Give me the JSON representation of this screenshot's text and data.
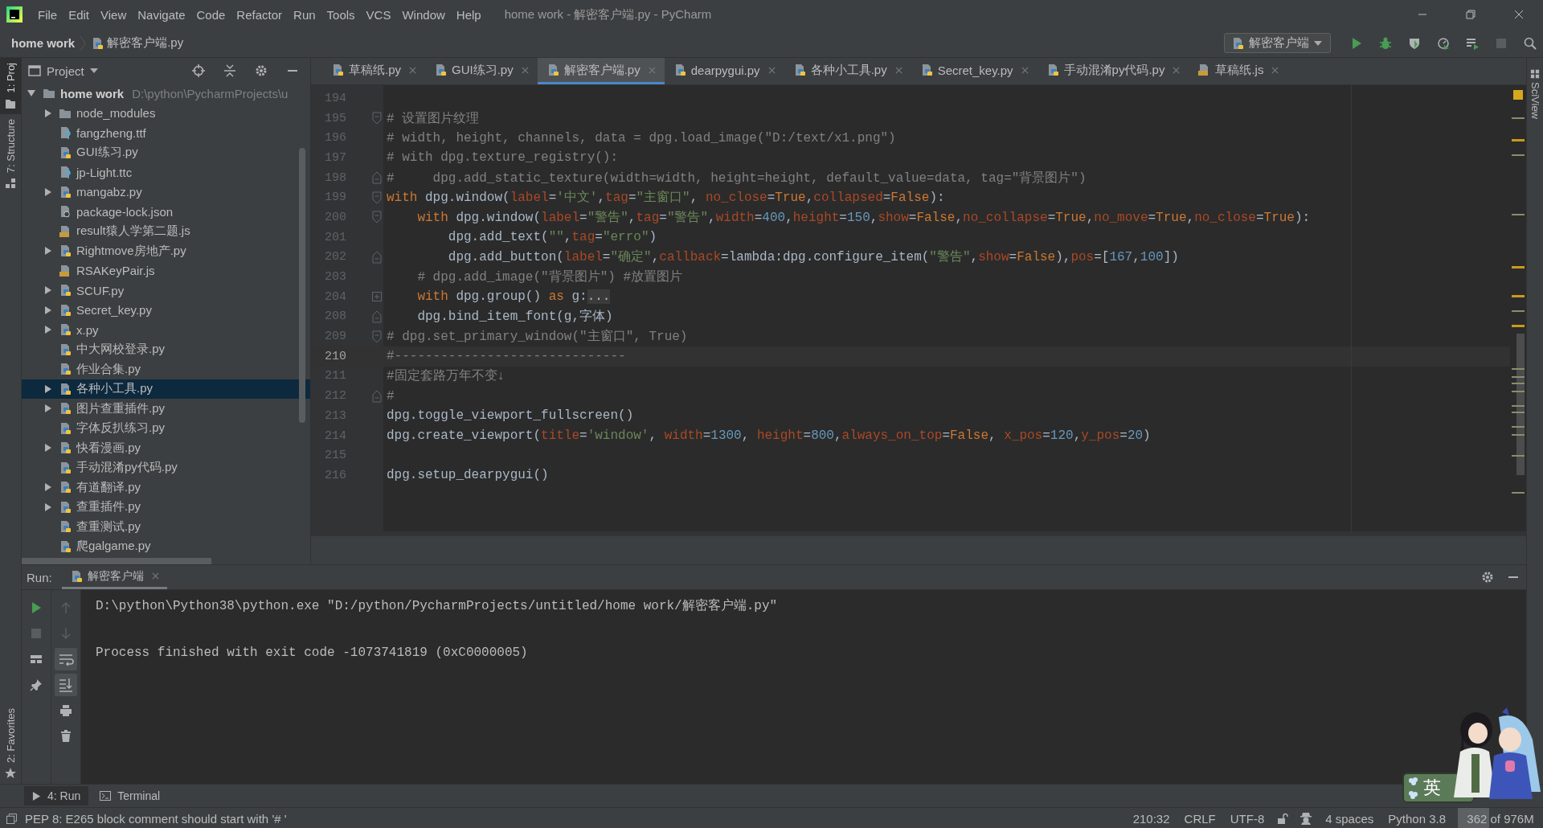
{
  "window": {
    "title": "home work - 解密客户端.py - PyCharm"
  },
  "menu": [
    "File",
    "Edit",
    "View",
    "Navigate",
    "Code",
    "Refactor",
    "Run",
    "Tools",
    "VCS",
    "Window",
    "Help"
  ],
  "breadcrumb": [
    {
      "label": "home work"
    },
    {
      "label": "解密客户端.py",
      "kind": "python"
    }
  ],
  "run_config": {
    "label": "解密客户端"
  },
  "side_tabs": {
    "left": [
      {
        "label": "1: Proj",
        "kind": "project",
        "selected": true
      },
      {
        "label": "7: Structure",
        "kind": "structure",
        "selected": false
      }
    ],
    "favorites": {
      "label": "2: Favorites"
    },
    "right": {
      "label": "SciView"
    }
  },
  "project": {
    "title": "Project",
    "tree": [
      {
        "label": "home work",
        "path": "D:\\python\\PycharmProjects\\u",
        "kind": "folder",
        "expanded": true,
        "selected": false,
        "children": [
          {
            "label": "node_modules",
            "kind": "folder",
            "expanded": false,
            "selected": false
          },
          {
            "label": "fangzheng.ttf",
            "kind": "font",
            "selected": false
          },
          {
            "label": "GUI练习.py",
            "kind": "python",
            "selected": false
          },
          {
            "label": "jp-Light.ttc",
            "kind": "font",
            "selected": false
          },
          {
            "label": "mangabz.py",
            "kind": "python",
            "expanded": false,
            "selected": false
          },
          {
            "label": "package-lock.json",
            "kind": "json",
            "selected": false
          },
          {
            "label": "result猿人学第二题.js",
            "kind": "js",
            "selected": false
          },
          {
            "label": "Rightmove房地产.py",
            "kind": "python",
            "expanded": false,
            "selected": false
          },
          {
            "label": "RSAKeyPair.js",
            "kind": "js",
            "selected": false
          },
          {
            "label": "SCUF.py",
            "kind": "python",
            "expanded": false,
            "selected": false
          },
          {
            "label": "Secret_key.py",
            "kind": "python",
            "expanded": false,
            "selected": false
          },
          {
            "label": "x.py",
            "kind": "python",
            "expanded": false,
            "selected": false
          },
          {
            "label": "中大网校登录.py",
            "kind": "python",
            "selected": false
          },
          {
            "label": "作业合集.py",
            "kind": "python",
            "selected": false
          },
          {
            "label": "各种小工具.py",
            "kind": "python",
            "expanded": false,
            "selected": true
          },
          {
            "label": "图片查重插件.py",
            "kind": "python",
            "expanded": false,
            "selected": false
          },
          {
            "label": "字体反扒练习.py",
            "kind": "python",
            "selected": false
          },
          {
            "label": "快看漫画.py",
            "kind": "python",
            "expanded": false,
            "selected": false
          },
          {
            "label": "手动混淆py代码.py",
            "kind": "python",
            "selected": false
          },
          {
            "label": "有道翻译.py",
            "kind": "python",
            "expanded": false,
            "selected": false
          },
          {
            "label": "查重插件.py",
            "kind": "python",
            "expanded": false,
            "selected": false
          },
          {
            "label": "查重测试.py",
            "kind": "python",
            "selected": false
          },
          {
            "label": "爬galgame.py",
            "kind": "python",
            "selected": false
          }
        ]
      }
    ]
  },
  "editor": {
    "tabs": [
      {
        "label": "草稿纸.py",
        "kind": "python",
        "selected": false
      },
      {
        "label": "GUI练习.py",
        "kind": "python",
        "selected": false
      },
      {
        "label": "解密客户端.py",
        "kind": "python",
        "selected": true
      },
      {
        "label": "dearpygui.py",
        "kind": "python",
        "selected": false
      },
      {
        "label": "各种小工具.py",
        "kind": "python",
        "selected": false
      },
      {
        "label": "Secret_key.py",
        "kind": "python",
        "selected": false
      },
      {
        "label": "手动混淆py代码.py",
        "kind": "python",
        "selected": false
      },
      {
        "label": "草稿纸.js",
        "kind": "js",
        "selected": false
      }
    ],
    "lines": [
      {
        "number": "194",
        "kind": "plain",
        "current": false
      },
      {
        "number": "195",
        "kind": "fold_start",
        "current": false,
        "tokens": [
          {
            "text": "# 设置图片纹理",
            "kind": "comment"
          }
        ]
      },
      {
        "number": "196",
        "kind": "plain",
        "current": false,
        "tokens": [
          {
            "text": "# width, height, channels, data = dpg.load_image(\"D:/text/x1.png\")",
            "kind": "comment"
          }
        ]
      },
      {
        "number": "197",
        "kind": "plain",
        "current": false,
        "tokens": [
          {
            "text": "# with dpg.texture_registry():",
            "kind": "comment"
          }
        ]
      },
      {
        "number": "198",
        "kind": "fold_end",
        "current": false,
        "tokens": [
          {
            "text": "#     dpg.add_static_texture(width=width, height=height, default_value=data, tag=\"背景图片\")",
            "kind": "comment"
          }
        ]
      },
      {
        "number": "199",
        "kind": "fold_start",
        "current": false,
        "tokens": [
          {
            "text": "with",
            "kind": "keyword"
          },
          {
            "text": " dpg.window(",
            "kind": "plain"
          },
          {
            "text": "label",
            "kind": "param"
          },
          {
            "text": "=",
            "kind": "plain"
          },
          {
            "text": "'中文'",
            "kind": "string"
          },
          {
            "text": ",",
            "kind": "plain"
          },
          {
            "text": "tag",
            "kind": "param"
          },
          {
            "text": "=",
            "kind": "plain"
          },
          {
            "text": "\"主窗口\"",
            "kind": "string"
          },
          {
            "text": ", ",
            "kind": "plain"
          },
          {
            "text": "no_close",
            "kind": "param"
          },
          {
            "text": "=",
            "kind": "plain"
          },
          {
            "text": "True",
            "kind": "keyword"
          },
          {
            "text": ",",
            "kind": "plain"
          },
          {
            "text": "collapsed",
            "kind": "param"
          },
          {
            "text": "=",
            "kind": "plain"
          },
          {
            "text": "False",
            "kind": "keyword"
          },
          {
            "text": "):",
            "kind": "plain"
          }
        ]
      },
      {
        "number": "200",
        "kind": "fold_start",
        "current": false,
        "tokens": [
          {
            "text": "    with",
            "kind": "keyword"
          },
          {
            "text": " dpg.window(",
            "kind": "plain"
          },
          {
            "text": "label",
            "kind": "param"
          },
          {
            "text": "=",
            "kind": "plain"
          },
          {
            "text": "\"警告\"",
            "kind": "string"
          },
          {
            "text": ",",
            "kind": "plain"
          },
          {
            "text": "tag",
            "kind": "param"
          },
          {
            "text": "=",
            "kind": "plain"
          },
          {
            "text": "\"警告\"",
            "kind": "string"
          },
          {
            "text": ",",
            "kind": "plain"
          },
          {
            "text": "width",
            "kind": "param"
          },
          {
            "text": "=",
            "kind": "plain"
          },
          {
            "text": "400",
            "kind": "number"
          },
          {
            "text": ",",
            "kind": "plain"
          },
          {
            "text": "height",
            "kind": "param"
          },
          {
            "text": "=",
            "kind": "plain"
          },
          {
            "text": "150",
            "kind": "number"
          },
          {
            "text": ",",
            "kind": "plain"
          },
          {
            "text": "show",
            "kind": "param"
          },
          {
            "text": "=",
            "kind": "plain"
          },
          {
            "text": "False",
            "kind": "keyword"
          },
          {
            "text": ",",
            "kind": "plain"
          },
          {
            "text": "no_collapse",
            "kind": "param"
          },
          {
            "text": "=",
            "kind": "plain"
          },
          {
            "text": "True",
            "kind": "keyword"
          },
          {
            "text": ",",
            "kind": "plain"
          },
          {
            "text": "no_move",
            "kind": "param"
          },
          {
            "text": "=",
            "kind": "plain"
          },
          {
            "text": "True",
            "kind": "keyword"
          },
          {
            "text": ",",
            "kind": "plain"
          },
          {
            "text": "no_close",
            "kind": "param"
          },
          {
            "text": "=",
            "kind": "plain"
          },
          {
            "text": "True",
            "kind": "keyword"
          },
          {
            "text": "):",
            "kind": "plain"
          }
        ]
      },
      {
        "number": "201",
        "kind": "plain",
        "current": false,
        "tokens": [
          {
            "text": "        dpg.add_text(",
            "kind": "plain"
          },
          {
            "text": "\"\"",
            "kind": "string"
          },
          {
            "text": ",",
            "kind": "plain"
          },
          {
            "text": "tag",
            "kind": "param"
          },
          {
            "text": "=",
            "kind": "plain"
          },
          {
            "text": "\"erro\"",
            "kind": "string"
          },
          {
            "text": ")",
            "kind": "plain"
          }
        ]
      },
      {
        "number": "202",
        "kind": "fold_end",
        "current": false,
        "tokens": [
          {
            "text": "        dpg.add_button(",
            "kind": "plain"
          },
          {
            "text": "label",
            "kind": "param"
          },
          {
            "text": "=",
            "kind": "plain"
          },
          {
            "text": "\"确定\"",
            "kind": "string"
          },
          {
            "text": ",",
            "kind": "plain"
          },
          {
            "text": "callback",
            "kind": "param"
          },
          {
            "text": "=lambda:dpg.configure_item(",
            "kind": "plain"
          },
          {
            "text": "\"警告\"",
            "kind": "string"
          },
          {
            "text": ",",
            "kind": "plain"
          },
          {
            "text": "show",
            "kind": "param"
          },
          {
            "text": "=",
            "kind": "plain"
          },
          {
            "text": "False",
            "kind": "keyword"
          },
          {
            "text": "),",
            "kind": "plain"
          },
          {
            "text": "pos",
            "kind": "param"
          },
          {
            "text": "=[",
            "kind": "plain"
          },
          {
            "text": "167",
            "kind": "number"
          },
          {
            "text": ",",
            "kind": "plain"
          },
          {
            "text": "100",
            "kind": "number"
          },
          {
            "text": "])",
            "kind": "plain"
          }
        ]
      },
      {
        "number": "203",
        "kind": "plain",
        "current": false,
        "tokens": [
          {
            "text": "    # dpg.add_image(\"背景图片\") #放置图片",
            "kind": "comment"
          }
        ]
      },
      {
        "number": "204",
        "kind": "fold_collapsed",
        "current": false,
        "tokens": [
          {
            "text": "    with",
            "kind": "keyword"
          },
          {
            "text": " dpg.group() ",
            "kind": "plain"
          },
          {
            "text": "as",
            "kind": "keyword"
          },
          {
            "text": " g:",
            "kind": "plain"
          },
          {
            "text": "...",
            "kind": "folded"
          }
        ]
      },
      {
        "number": "208",
        "kind": "fold_end",
        "current": false,
        "tokens": [
          {
            "text": "    dpg.bind_item_font(g,字体)",
            "kind": "plain"
          }
        ]
      },
      {
        "number": "209",
        "kind": "fold_start",
        "current": false,
        "tokens": [
          {
            "text": "# dpg.set_primary_window(\"主窗口\", True)",
            "kind": "comment"
          }
        ]
      },
      {
        "number": "210",
        "kind": "plain",
        "current": true,
        "tokens": [
          {
            "text": "#------------------------------",
            "kind": "comment"
          }
        ]
      },
      {
        "number": "211",
        "kind": "plain",
        "current": false,
        "tokens": [
          {
            "text": "#固定套路万年不变↓",
            "kind": "comment"
          }
        ]
      },
      {
        "number": "212",
        "kind": "fold_end",
        "current": false,
        "tokens": [
          {
            "text": "#",
            "kind": "comment"
          }
        ]
      },
      {
        "number": "213",
        "kind": "plain",
        "current": false,
        "tokens": [
          {
            "text": "dpg.toggle_viewport_fullscreen()",
            "kind": "plain"
          }
        ]
      },
      {
        "number": "214",
        "kind": "plain",
        "current": false,
        "tokens": [
          {
            "text": "dpg.create_viewport(",
            "kind": "plain"
          },
          {
            "text": "title",
            "kind": "param"
          },
          {
            "text": "=",
            "kind": "plain"
          },
          {
            "text": "'window'",
            "kind": "string"
          },
          {
            "text": ", ",
            "kind": "plain"
          },
          {
            "text": "width",
            "kind": "param"
          },
          {
            "text": "=",
            "kind": "plain"
          },
          {
            "text": "1300",
            "kind": "number"
          },
          {
            "text": ", ",
            "kind": "plain"
          },
          {
            "text": "height",
            "kind": "param"
          },
          {
            "text": "=",
            "kind": "plain"
          },
          {
            "text": "800",
            "kind": "number"
          },
          {
            "text": ",",
            "kind": "plain"
          },
          {
            "text": "always_on_top",
            "kind": "param"
          },
          {
            "text": "=",
            "kind": "plain"
          },
          {
            "text": "False",
            "kind": "keyword"
          },
          {
            "text": ", ",
            "kind": "plain"
          },
          {
            "text": "x_pos",
            "kind": "param"
          },
          {
            "text": "=",
            "kind": "plain"
          },
          {
            "text": "120",
            "kind": "number"
          },
          {
            "text": ",",
            "kind": "plain"
          },
          {
            "text": "y_pos",
            "kind": "param"
          },
          {
            "text": "=",
            "kind": "plain"
          },
          {
            "text": "20",
            "kind": "number"
          },
          {
            "text": ")",
            "kind": "plain"
          }
        ]
      },
      {
        "number": "215",
        "kind": "plain",
        "current": false
      },
      {
        "number": "216",
        "kind": "plain",
        "current": false,
        "tokens": [
          {
            "text": "dpg.setup_dearpygui()",
            "kind": "plain"
          }
        ]
      }
    ]
  },
  "run": {
    "label": "Run:",
    "tabs": [
      {
        "label": "解密客户端",
        "selected": true
      }
    ],
    "output": [
      "D:\\python\\Python38\\python.exe \"D:/python/PycharmProjects/untitled/home work/解密客户端.py\"",
      "Process finished with exit code -1073741819 (0xC0000005)"
    ]
  },
  "tool_windows": [
    {
      "label": "4: Run",
      "kind": "run",
      "selected": true
    },
    {
      "label": "Terminal",
      "kind": "terminal",
      "selected": false
    }
  ],
  "status_bar": {
    "message": "PEP 8: E265 block comment should start with '# '",
    "position": "210:32",
    "line_separator": "CRLF",
    "encoding": "UTF-8",
    "indent": "4 spaces",
    "interpreter": "Python 3.8",
    "memory": {
      "text": "362 of 976M",
      "level": 0.37
    }
  },
  "ime": {
    "label": "英"
  }
}
